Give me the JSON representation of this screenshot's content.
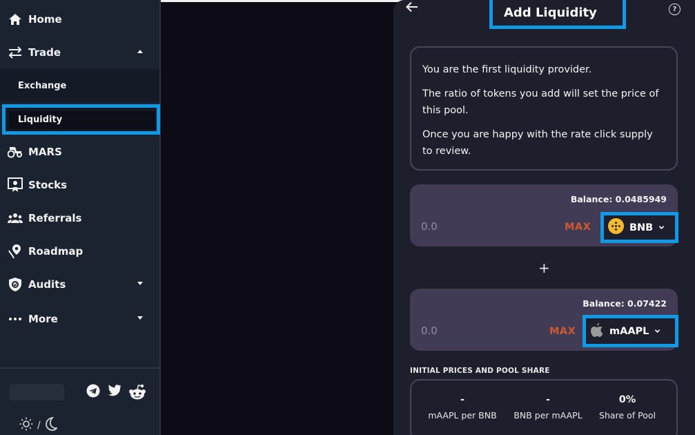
{
  "sidebar": {
    "items": [
      {
        "label": "Home",
        "icon": "home-icon"
      },
      {
        "label": "Trade",
        "icon": "swap-icon",
        "expanded": true
      },
      {
        "label": "MARS",
        "icon": "tractor-icon"
      },
      {
        "label": "Stocks",
        "icon": "stock-certificate-icon"
      },
      {
        "label": "Referrals",
        "icon": "users-icon"
      },
      {
        "label": "Roadmap",
        "icon": "roadmap-icon"
      },
      {
        "label": "Audits",
        "icon": "shield-check-icon",
        "expanded": false
      },
      {
        "label": "More",
        "icon": "ellipsis-icon",
        "expanded": false
      }
    ],
    "trade_sub": [
      {
        "label": "Exchange"
      },
      {
        "label": "Liquidity",
        "active": true
      }
    ],
    "theme_separator": "/"
  },
  "panel": {
    "title": "Add Liquidity",
    "info_lines": [
      "You are the first liquidity provider.",
      "The ratio of tokens you add will set the price of this pool.",
      "Once you are happy with the rate click supply to review."
    ],
    "plus": "+",
    "input_a": {
      "balance": "Balance: 0.0485949",
      "placeholder": "0.0",
      "max_label": "MAX",
      "token": "BNB",
      "token_icon": "bnb-icon"
    },
    "input_b": {
      "balance": "Balance: 0.07422",
      "placeholder": "0.0",
      "max_label": "MAX",
      "token": "mAAPL",
      "token_icon": "apple-icon"
    },
    "prices_title": "INITIAL PRICES AND POOL SHARE",
    "prices": [
      {
        "value": "-",
        "label": "mAAPL per BNB"
      },
      {
        "value": "-",
        "label": "BNB per mAAPL"
      },
      {
        "value": "0%",
        "label": "Share of Pool"
      }
    ]
  },
  "colors": {
    "highlight": "#1199e6",
    "max": "#d0582f",
    "bnb": "#f3ba2f",
    "card": "#413b56",
    "panel": "#1e1f2d",
    "sidebar": "#1b2230"
  }
}
